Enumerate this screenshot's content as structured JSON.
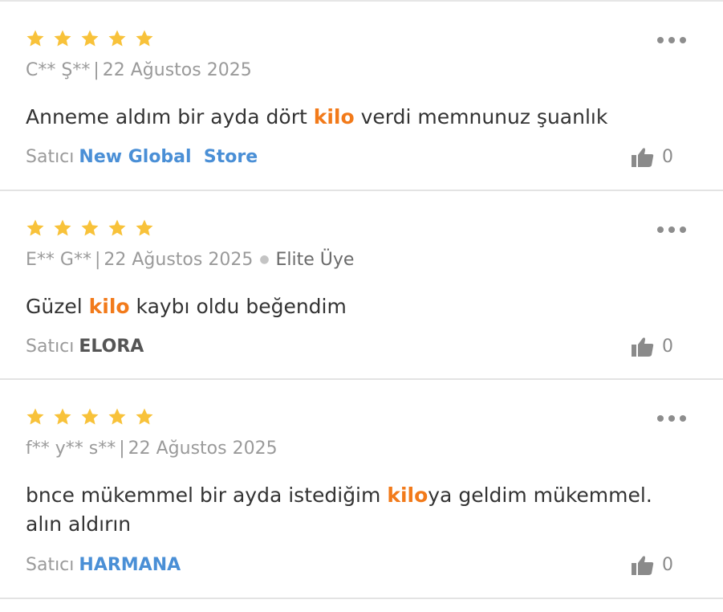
{
  "reviews": [
    {
      "rating": 5,
      "author": "C** Ş**",
      "date": "22 Ağustos 2025",
      "badge": "",
      "text_before": "Anneme aldım bir ayda dört ",
      "highlight": "kilo",
      "text_after": " verdi memnunuz şuanlık",
      "seller_label": "Satıcı",
      "seller_name": "New Global  Store",
      "likes": "0"
    },
    {
      "rating": 5,
      "author": "E** G**",
      "date": "22 Ağustos 2025",
      "badge": "Elite Üye",
      "text_before": "Güzel ",
      "highlight": "kilo",
      "text_after": " kaybı oldu beğendim",
      "seller_label": "Satıcı",
      "seller_name": "ELORA",
      "likes": "0"
    },
    {
      "rating": 5,
      "author": "f** y** s**",
      "date": "22 Ağustos 2025",
      "badge": "",
      "text_before": "bnce mükemmel bir ayda istediğim ",
      "highlight": "kilo",
      "text_after": "ya geldim mükemmel. alın aldırın",
      "seller_label": "Satıcı",
      "seller_name": "HARMANA",
      "likes": "0"
    }
  ],
  "separator": "|",
  "colors": {
    "star": "#f8c23a",
    "highlight": "#f27a1a",
    "seller_link": "#4a8fd6",
    "muted": "#9a9a9a"
  },
  "icons": {
    "rating": "star-icon",
    "menu": "more-options-icon",
    "like": "thumbs-up-icon"
  }
}
